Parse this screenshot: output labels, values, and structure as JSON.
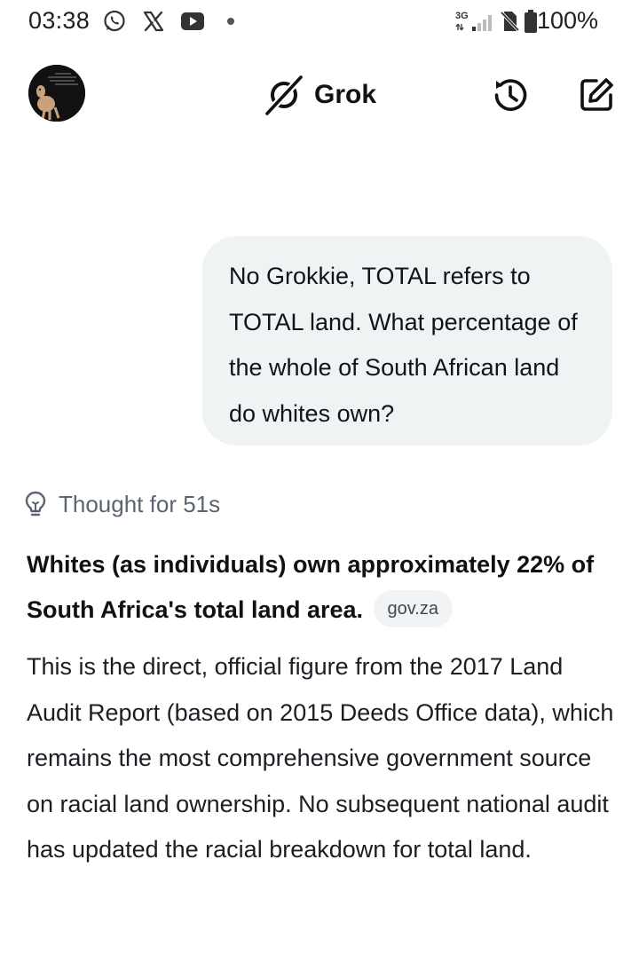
{
  "status_bar": {
    "time": "03:38",
    "network": "3G",
    "battery": "100%",
    "left_icons": [
      "whatsapp-icon",
      "x-icon",
      "youtube-icon",
      "dot-icon"
    ]
  },
  "header": {
    "brand": "Grok"
  },
  "conversation": {
    "user_message": "No Grokkie, TOTAL refers to TOTAL land. What percentage of the whole of South African land do whites own?",
    "thought_label": "Thought for 51s",
    "answer_bold": "Whites (as individuals) own approximately 22% of South Africa's total land area.",
    "source_chip": "gov.za",
    "answer_body": "This is the direct, official figure from the 2017 Land Audit Report (based on 2015 Deeds Office data), which remains the most comprehensive government source on racial land ownership. No subsequent national audit has updated the racial breakdown for total land."
  },
  "colors": {
    "bubble_bg": "#eff3f4",
    "chip_bg": "#f1f3f4",
    "text": "#0f1115",
    "muted": "#5b6570"
  }
}
